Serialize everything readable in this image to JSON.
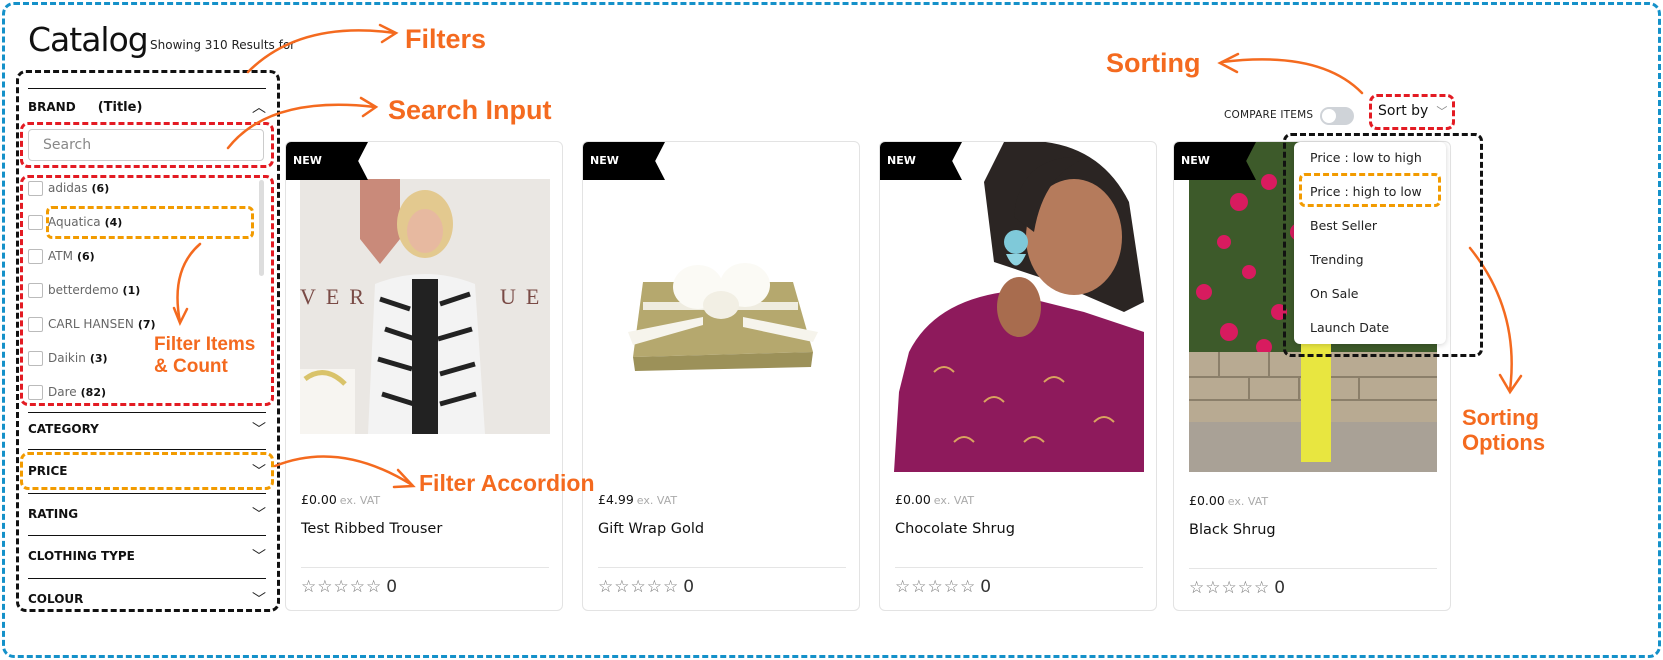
{
  "header": {
    "title": "Catalog",
    "results_text": "Showing 310 Results for"
  },
  "filters": {
    "brand": {
      "label": "BRAND",
      "annotation": "(Title)",
      "search_placeholder": "Search",
      "search_value": "",
      "items": [
        {
          "name": "adidas",
          "count": "(6)"
        },
        {
          "name": "Aquatica",
          "count": "(4)"
        },
        {
          "name": "ATM",
          "count": "(6)"
        },
        {
          "name": "betterdemo",
          "count": "(1)"
        },
        {
          "name": "CARL HANSEN",
          "count": "(7)"
        },
        {
          "name": "Daikin",
          "count": "(3)"
        },
        {
          "name": "Dare",
          "count": "(82)"
        }
      ]
    },
    "accordions": [
      {
        "label": "CATEGORY"
      },
      {
        "label": "PRICE"
      },
      {
        "label": "RATING"
      },
      {
        "label": "CLOTHING TYPE"
      },
      {
        "label": "COLOUR"
      }
    ]
  },
  "toolbar": {
    "compare_label": "COMPARE ITEMS",
    "compare_on": false,
    "sort_label": "Sort by",
    "sort_options": [
      "Price : low to high",
      "Price : high to low",
      "Best Seller",
      "Trending",
      "On Sale",
      "Launch Date"
    ]
  },
  "products": [
    {
      "badge": "NEW",
      "price": "£0.00",
      "vat": "ex. VAT",
      "name": "Test Ribbed Trouser",
      "rating": 0,
      "rating_count": "0"
    },
    {
      "badge": "NEW",
      "price": "£4.99",
      "vat": "ex. VAT",
      "name": "Gift Wrap Gold",
      "rating": 0,
      "rating_count": "0"
    },
    {
      "badge": "NEW",
      "price": "£0.00",
      "vat": "ex. VAT",
      "name": "Chocolate Shrug",
      "rating": 0,
      "rating_count": "0"
    },
    {
      "badge": "NEW",
      "price": "£0.00",
      "vat": "ex. VAT",
      "name": "Black Shrug",
      "rating": 0,
      "rating_count": "0"
    }
  ],
  "annotations": {
    "filters": "Filters",
    "search_input": "Search Input",
    "filter_items_1": "Filter Items",
    "filter_items_2": "& Count",
    "filter_accordion": "Filter Accordion",
    "sorting": "Sorting",
    "sorting_options_1": "Sorting",
    "sorting_options_2": "Options"
  },
  "icons": {
    "chevron_up": "︿",
    "chevron_down": "﹀",
    "star": "☆"
  },
  "colors": {
    "annotation_orange": "#f46a1f",
    "frame_blue": "#1591c9",
    "highlight_red": "#e31b23",
    "highlight_amber": "#f29b00"
  }
}
